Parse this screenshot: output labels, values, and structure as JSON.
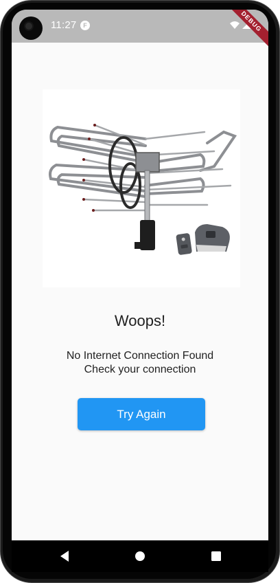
{
  "status_bar": {
    "time": "11:27",
    "app_icon_letter": "F",
    "background_color": "#b9b9b9",
    "debug_banner": "DEBUG",
    "icons": [
      "camera-cutout",
      "flutter-notification-icon",
      "wifi-icon",
      "signal-icon",
      "battery-icon"
    ]
  },
  "screen": {
    "background_color": "#fafafa",
    "image_name": "tv-antenna-icon",
    "title": "Woops!",
    "message_line1": "No Internet Connection Found",
    "message_line2": "Check your connection",
    "retry_button_label": "Try Again",
    "accent_color": "#2196f3"
  },
  "nav_bar": {
    "buttons": [
      "back-icon",
      "home-icon",
      "recents-icon"
    ],
    "background_color": "#000000"
  }
}
